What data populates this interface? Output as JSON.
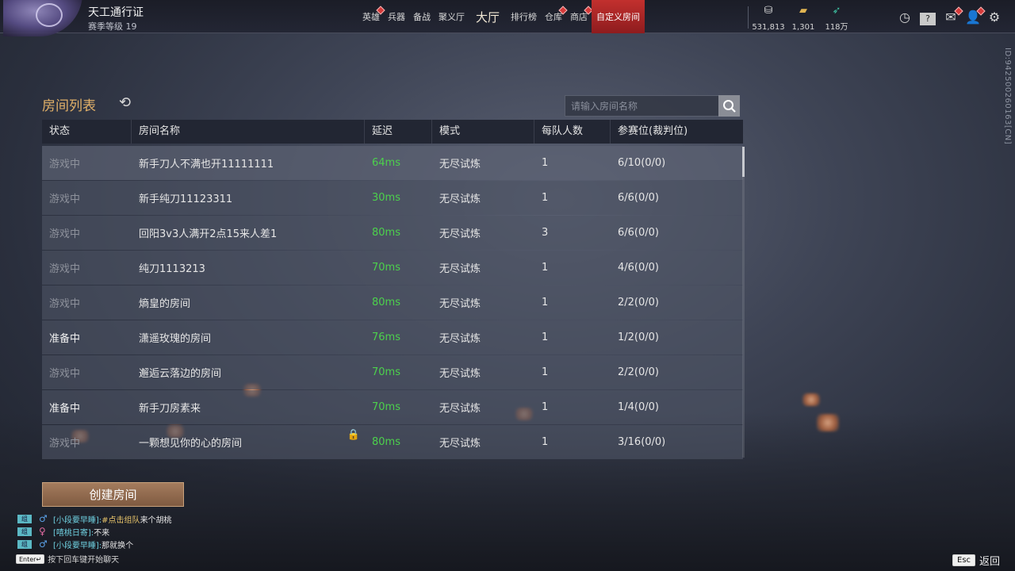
{
  "header": {
    "pass_title": "天工通行证",
    "season_level": "赛季等级 19"
  },
  "nav": {
    "items": [
      {
        "label": "英雄",
        "badge": true
      },
      {
        "label": "兵器",
        "badge": false
      },
      {
        "label": "备战",
        "badge": false
      },
      {
        "label": "聚义厅",
        "badge": false
      },
      {
        "label": "大厅",
        "badge": false
      },
      {
        "label": "排行榜",
        "badge": false
      },
      {
        "label": "仓库",
        "badge": true
      },
      {
        "label": "商店",
        "badge": true
      },
      {
        "label": "自定义房间",
        "badge": false,
        "active": true
      }
    ]
  },
  "resources": [
    {
      "icon": "coin-icon",
      "value": "531,813"
    },
    {
      "icon": "gold-ingot-icon",
      "value": "1,301"
    },
    {
      "icon": "feather-icon",
      "value": "118万"
    }
  ],
  "side_id": "ID:94250026016​3[CN]",
  "room_list": {
    "title": "房间列表",
    "search_placeholder": "请输入房间名称",
    "columns": [
      "状态",
      "房间名称",
      "延迟",
      "模式",
      "每队人数",
      "参赛位(裁判位)"
    ],
    "rows": [
      {
        "status": "游戏中",
        "name": "新手刀人不满也开11111111",
        "latency": "64ms",
        "mode": "无尽试炼",
        "per_team": "1",
        "slots": "6/10(0/0)",
        "locked": false
      },
      {
        "status": "游戏中",
        "name": "新手纯刀11123311",
        "latency": "30ms",
        "mode": "无尽试炼",
        "per_team": "1",
        "slots": "6/6(0/0)",
        "locked": false
      },
      {
        "status": "游戏中",
        "name": "回阳3v3人满开2点15来人差1",
        "latency": "80ms",
        "mode": "无尽试炼",
        "per_team": "3",
        "slots": "6/6(0/0)",
        "locked": false
      },
      {
        "status": "游戏中",
        "name": "纯刀1113213",
        "latency": "70ms",
        "mode": "无尽试炼",
        "per_team": "1",
        "slots": "4/6(0/0)",
        "locked": false
      },
      {
        "status": "游戏中",
        "name": "熵皇的房间",
        "latency": "80ms",
        "mode": "无尽试炼",
        "per_team": "1",
        "slots": "2/2(0/0)",
        "locked": false
      },
      {
        "status": "准备中",
        "name": "潇遥玫瑰的房间",
        "latency": "76ms",
        "mode": "无尽试炼",
        "per_team": "1",
        "slots": "1/2(0/0)",
        "locked": false
      },
      {
        "status": "游戏中",
        "name": "邂逅云落边的房间",
        "latency": "70ms",
        "mode": "无尽试炼",
        "per_team": "1",
        "slots": "2/2(0/0)",
        "locked": false
      },
      {
        "status": "准备中",
        "name": "新手刀房素来",
        "latency": "70ms",
        "mode": "无尽试炼",
        "per_team": "1",
        "slots": "1/4(0/0)",
        "locked": false
      },
      {
        "status": "游戏中",
        "name": "一颗想见你的心的房间",
        "latency": "80ms",
        "mode": "无尽试炼",
        "per_team": "1",
        "slots": "3/16(0/0)",
        "locked": true
      }
    ],
    "create_button": "创建房间"
  },
  "chat": {
    "lines": [
      {
        "gender": "male",
        "name": "[小段要早睡]:",
        "link": "#点击组队",
        "text": " 来个胡桃"
      },
      {
        "gender": "female",
        "name": "[嘻桃日寄]:",
        "link": "",
        "text": "不来"
      },
      {
        "gender": "male",
        "name": "[小段要早睡]:",
        "link": "",
        "text": "那就换个"
      }
    ],
    "enter_key": "Enter↵",
    "enter_hint": "按下回车键开始聊天"
  },
  "footer": {
    "esc_key": "Esc",
    "back_label": "返回"
  },
  "colors": {
    "accent_title": "#e1b068",
    "latency_green": "#4cd14c",
    "nav_active": "#c2302e"
  }
}
